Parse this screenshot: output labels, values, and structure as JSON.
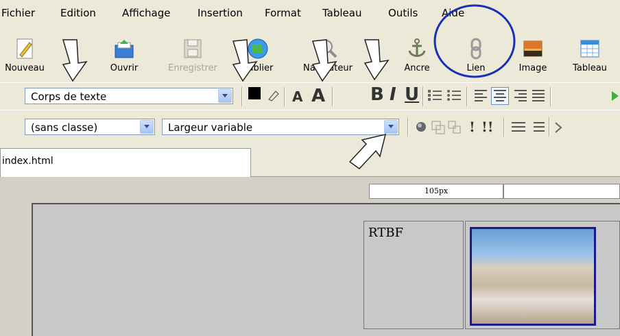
{
  "menubar": {
    "items": [
      {
        "label": "Fichier"
      },
      {
        "label": "Edition"
      },
      {
        "label": "Affichage"
      },
      {
        "label": "Insertion"
      },
      {
        "label": "Format"
      },
      {
        "label": "Tableau"
      },
      {
        "label": "Outils"
      },
      {
        "label": "Aide"
      }
    ]
  },
  "toolbar": {
    "buttons": [
      {
        "label": "Nouveau",
        "icon": "new-document-icon"
      },
      {
        "label": "Ouvrir",
        "icon": "open-folder-icon"
      },
      {
        "label": "Enregistrer",
        "icon": "save-disk-icon",
        "disabled": true
      },
      {
        "label": "Publier",
        "icon": "globe-publish-icon"
      },
      {
        "label": "Navigateur",
        "icon": "browser-magnifier-icon"
      },
      {
        "label": "Ancre",
        "icon": "anchor-icon"
      },
      {
        "label": "Lien",
        "icon": "link-chain-icon"
      },
      {
        "label": "Image",
        "icon": "image-landscape-icon"
      },
      {
        "label": "Tableau",
        "icon": "table-icon"
      }
    ]
  },
  "format_bar": {
    "paragraph_style": "Corps de texte",
    "class_select": "(sans classe)",
    "width_select": "Largeur variable",
    "bold": "B",
    "italic": "I",
    "underline": "U",
    "small_excl": "!",
    "big_excl": "!!"
  },
  "tabs": [
    {
      "label": "index.html"
    }
  ],
  "editor": {
    "ruler_label": "105px",
    "cell_text": "RTBF"
  },
  "colors": {
    "annotation_circle": "#1a2fb8",
    "text_color_swatch": "#000000",
    "photo_border": "#1a1a8c"
  }
}
